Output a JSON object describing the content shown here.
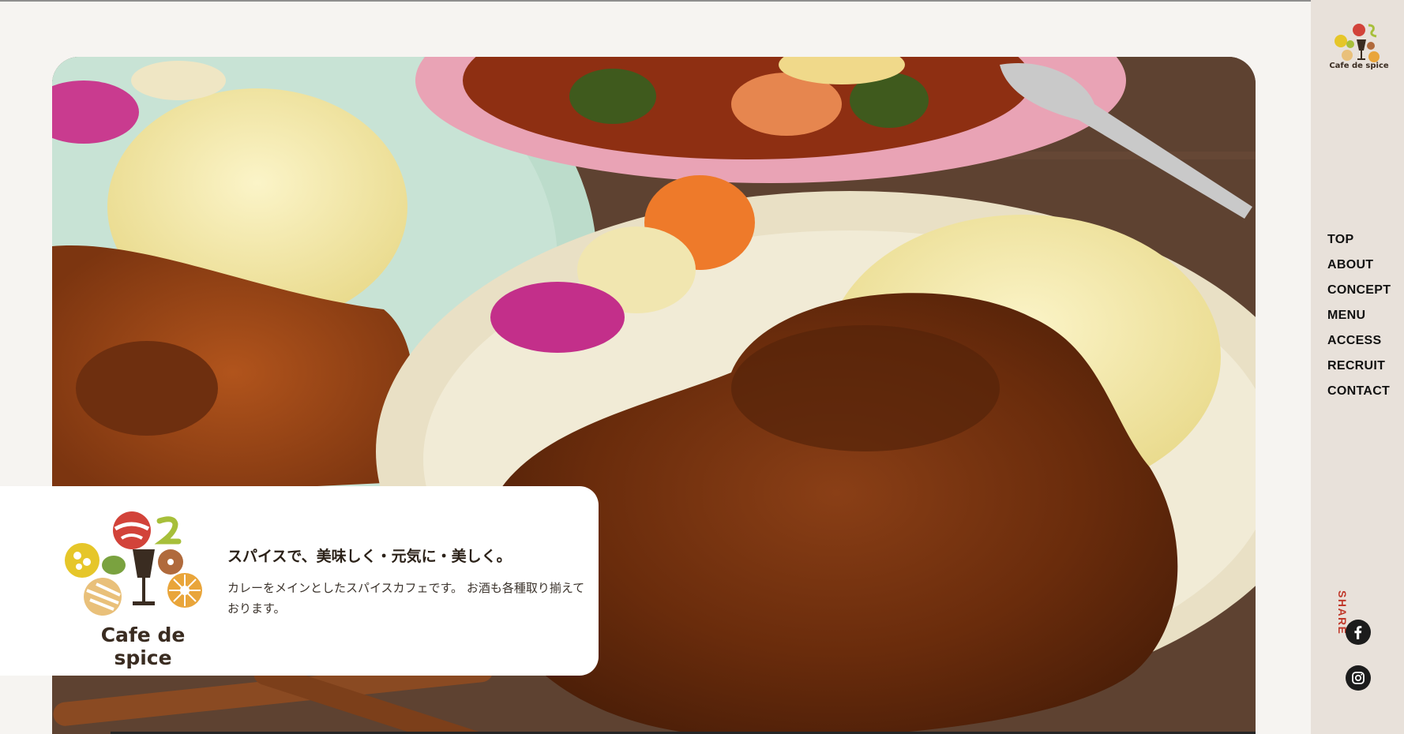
{
  "brand": {
    "name": "Cafe de spice"
  },
  "nav": {
    "items": [
      "TOP",
      "ABOUT",
      "CONCEPT",
      "MENU",
      "ACCESS",
      "RECRUIT",
      "CONTACT"
    ]
  },
  "share": {
    "label": "SHARE",
    "icons": [
      "facebook-icon",
      "instagram-icon"
    ]
  },
  "intro": {
    "title": "スパイスで、美味しく・元気に・美しく。",
    "description": "カレーをメインとしたスパイスカフェです。 お酒も各種取り揃えております。"
  },
  "colors": {
    "background": "#f6f4f1",
    "sidebar": "#e8e1da",
    "share_accent": "#c0392b",
    "logo_red": "#d2433a",
    "logo_yellow": "#e6c629",
    "logo_green": "#a7bf3a",
    "logo_orange": "#e9a53a"
  }
}
